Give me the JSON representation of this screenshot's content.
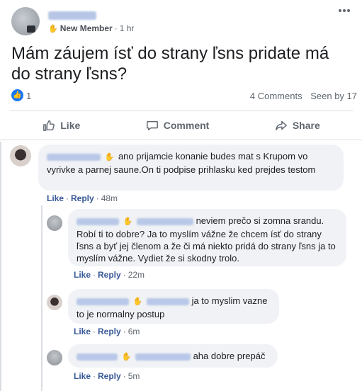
{
  "post": {
    "author_name": "Jan Gelnry",
    "badge": "New Member",
    "time": "1 hr",
    "text": "Mám záujem ísť do strany ľsns pridate má do strany ľsns?",
    "like_count": "1",
    "comments": "4 Comments",
    "seen": "Seen by 17"
  },
  "actions": {
    "like": "Like",
    "comment": "Comment",
    "share": "Share"
  },
  "comments": [
    {
      "author": "Fero Mohajka",
      "text": "ano prijamcie konanie budes mat s Krupom vo vyrivke a parnej saune.On ti podpise prihlasku ked prejdes testom",
      "like": "Like",
      "reply": "Reply",
      "time": "48m"
    },
    {
      "author": "Jan Gelnry",
      "mention": "Fero Mohajka",
      "text": "neviem prečo si zomna srandu. Robí ti to dobre? Ja to myslím vážne že chcem ísť do strany ľsns a byť jej členom a že či má niekto pridá do strany ľsns ja to myslím vážne. Vydiet že si skodny trolo.",
      "like": "Like",
      "reply": "Reply",
      "time": "22m"
    },
    {
      "author": "Fero Mohajka",
      "mention": "Jan Gelnry",
      "text": "ja to myslim vazne to je normalny postup",
      "like": "Like",
      "reply": "Reply",
      "time": "6m"
    },
    {
      "author": "Jan Gelnry",
      "mention": "Fero Mohajka",
      "text": "aha dobre prepáč",
      "like": "Like",
      "reply": "Reply",
      "time": "5m"
    }
  ],
  "icons": {
    "wave": "wave-hand-icon",
    "more": "more-options-icon",
    "like_reaction": "thumbs-up-icon"
  },
  "colors": {
    "accent": "#1877f2",
    "link": "#385898",
    "bubble": "#f0f2f5"
  }
}
